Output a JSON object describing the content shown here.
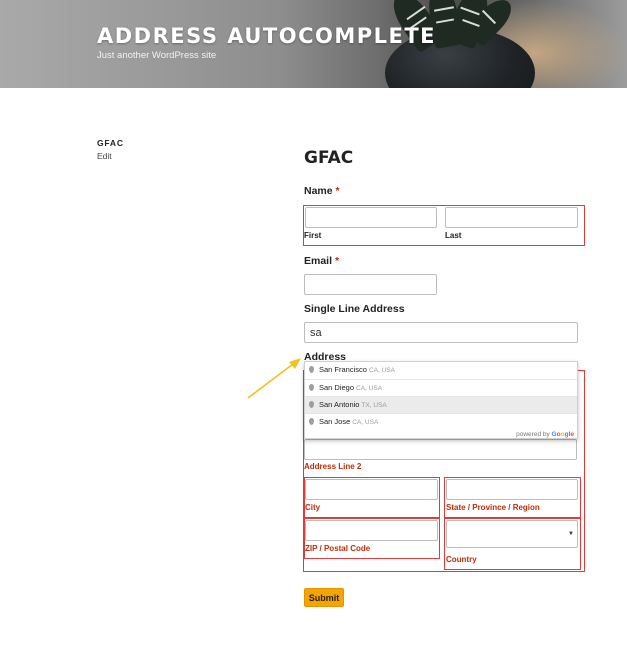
{
  "site": {
    "title": "ADDRESS AUTOCOMPLETE",
    "tagline": "Just another WordPress site"
  },
  "sidebar": {
    "title": "GFAC",
    "edit_label": "Edit"
  },
  "form": {
    "title": "GFAC",
    "name": {
      "label": "Name",
      "required_mark": "*",
      "first_label": "First",
      "last_label": "Last",
      "first_value": "",
      "last_value": ""
    },
    "email": {
      "label": "Email",
      "required_mark": "*",
      "value": ""
    },
    "single_line_address": {
      "label": "Single Line Address",
      "value": "sa"
    },
    "address": {
      "label": "Address",
      "line2_label": "Address Line 2",
      "city_label": "City",
      "state_label": "State / Province / Region",
      "zip_label": "ZIP / Postal Code",
      "country_label": "Country",
      "country_value": ""
    },
    "submit_label": "Submit"
  },
  "autocomplete": {
    "suggestions": [
      {
        "main": "San Francisco",
        "secondary": "CA, USA"
      },
      {
        "main": "San Diego",
        "secondary": "CA, USA"
      },
      {
        "main": "San Antonio",
        "secondary": "TX, USA"
      },
      {
        "main": "San Jose",
        "secondary": "CA, USA"
      }
    ],
    "highlighted_index": 2,
    "powered_by": "powered by",
    "google_letters": [
      "G",
      "o",
      "o",
      "g",
      "l",
      "e"
    ]
  },
  "colors": {
    "required": "#c02b0a",
    "error_outline": "#e23b3b",
    "submit_bg": "#f6a400",
    "annotation_arrow": "#f5c21b"
  }
}
